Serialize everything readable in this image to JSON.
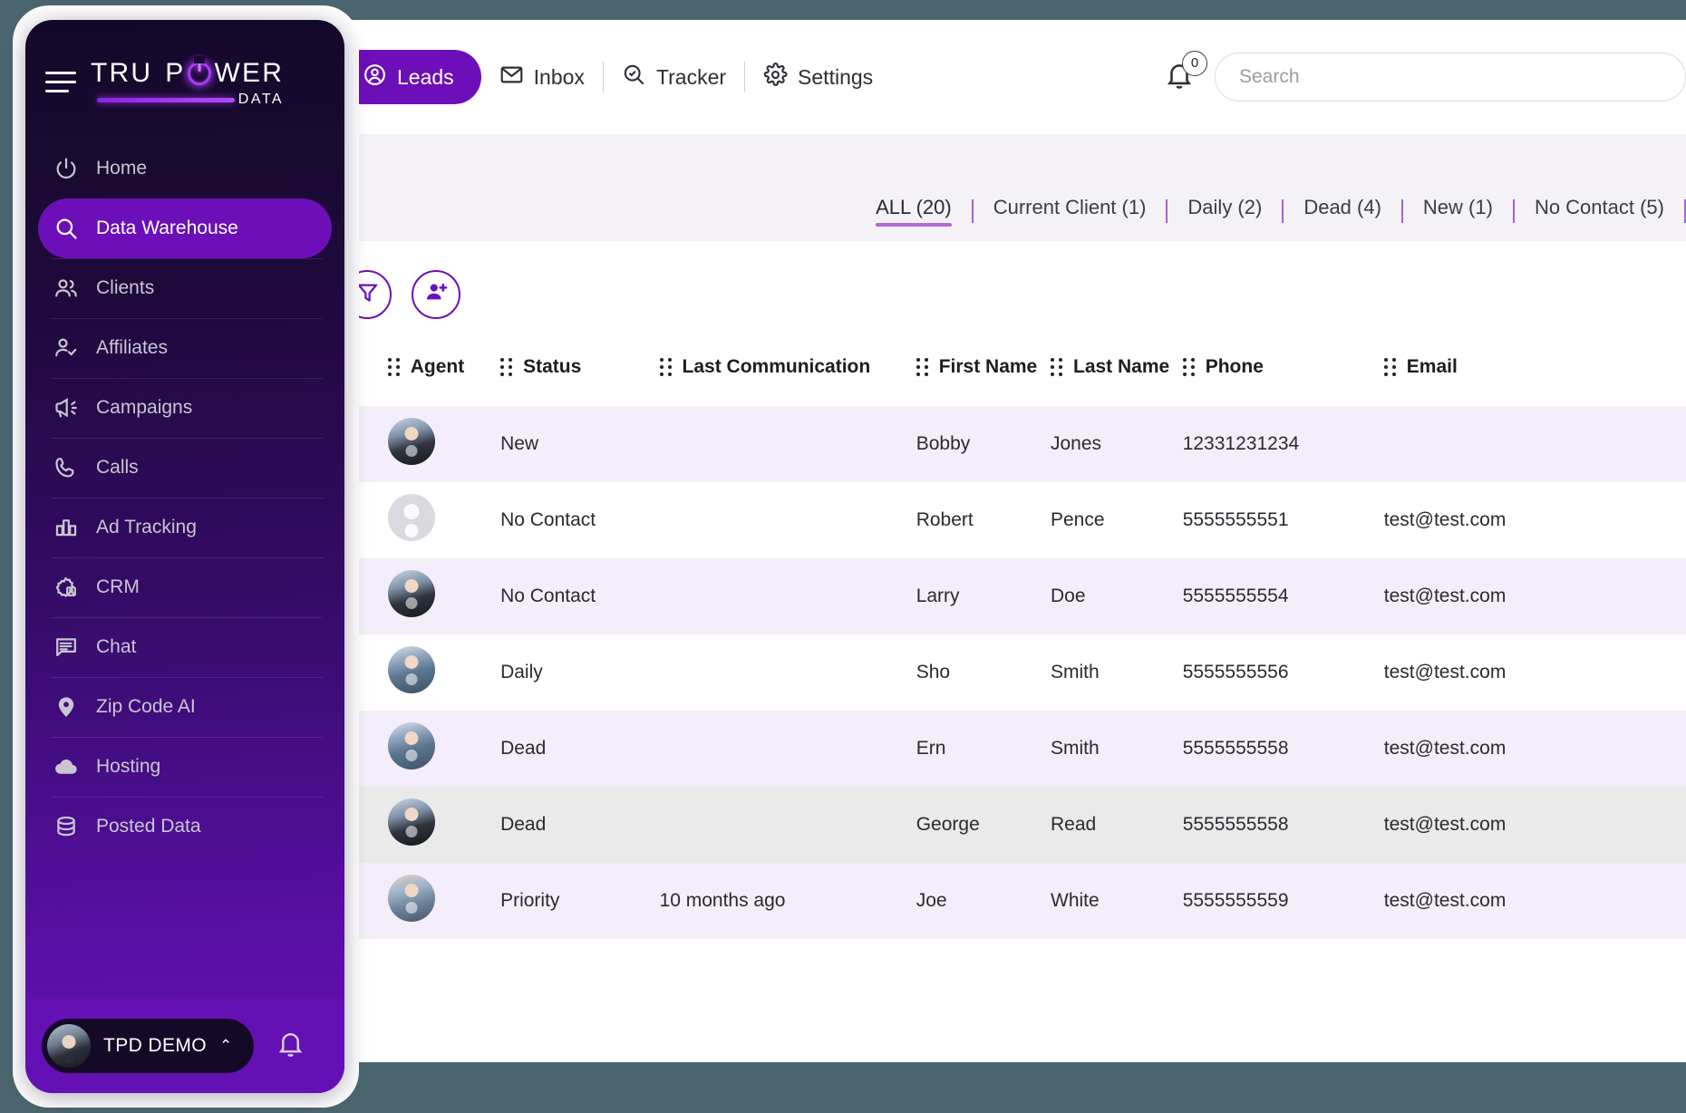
{
  "brand": {
    "line1_a": "TRU",
    "line1_b": "P",
    "line1_c": "WER",
    "line2": "DATA"
  },
  "sidebar": {
    "items": [
      {
        "label": "Home",
        "icon": "power-icon",
        "active": false
      },
      {
        "label": "Data Warehouse",
        "icon": "search-icon",
        "active": true
      },
      {
        "label": "Clients",
        "icon": "users-icon",
        "active": false
      },
      {
        "label": "Affiliates",
        "icon": "user-check-icon",
        "active": false
      },
      {
        "label": "Campaigns",
        "icon": "megaphone-icon",
        "active": false
      },
      {
        "label": "Calls",
        "icon": "phone-icon",
        "active": false
      },
      {
        "label": "Ad Tracking",
        "icon": "bar-chart-icon",
        "active": false
      },
      {
        "label": "CRM",
        "icon": "gear-contact-icon",
        "active": false
      },
      {
        "label": "Chat",
        "icon": "chat-icon",
        "active": false
      },
      {
        "label": "Zip Code AI",
        "icon": "map-pin-icon",
        "active": false
      },
      {
        "label": "Hosting",
        "icon": "cloud-icon",
        "active": false
      },
      {
        "label": "Posted Data",
        "icon": "database-icon",
        "active": false
      }
    ],
    "footer": {
      "user_name": "TPD DEMO",
      "chevron": "⌃",
      "bell_icon": "bell-icon",
      "avatar_icon": "avatar"
    }
  },
  "topnav": {
    "tabs": [
      {
        "label": "Leads",
        "icon": "user-circle-icon",
        "active": true
      },
      {
        "label": "Inbox",
        "icon": "envelope-icon",
        "active": false
      },
      {
        "label": "Tracker",
        "icon": "search-check-icon",
        "active": false
      },
      {
        "label": "Settings",
        "icon": "gear-icon",
        "active": false
      }
    ],
    "notifications": {
      "icon": "bell-icon",
      "count": "0"
    },
    "search": {
      "placeholder": "Search",
      "value": ""
    }
  },
  "filters": {
    "tabs": [
      {
        "label": "ALL (20)",
        "active": true
      },
      {
        "label": "Current Client (1)",
        "active": false
      },
      {
        "label": "Daily (2)",
        "active": false
      },
      {
        "label": "Dead (4)",
        "active": false
      },
      {
        "label": "New (1)",
        "active": false
      },
      {
        "label": "No Contact (5)",
        "active": false
      }
    ]
  },
  "actions": {
    "filter_button": "filter-icon",
    "add_lead_button": "add-user-icon"
  },
  "table": {
    "columns": [
      "Agent",
      "Status",
      "Last Communication",
      "First Name",
      "Last Name",
      "Phone",
      "Email"
    ],
    "rows": [
      {
        "avatar": "av-a",
        "status": "New",
        "last_communication": "",
        "first_name": "Bobby",
        "last_name": "Jones",
        "phone": "12331231234",
        "email": ""
      },
      {
        "avatar": "av-b",
        "status": "No Contact",
        "last_communication": "",
        "first_name": "Robert",
        "last_name": "Pence",
        "phone": "5555555551",
        "email": "test@test.com"
      },
      {
        "avatar": "av-a",
        "status": "No Contact",
        "last_communication": "",
        "first_name": "Larry",
        "last_name": "Doe",
        "phone": "5555555554",
        "email": "test@test.com"
      },
      {
        "avatar": "av-c",
        "status": "Daily",
        "last_communication": "",
        "first_name": "Sho",
        "last_name": "Smith",
        "phone": "5555555556",
        "email": "test@test.com"
      },
      {
        "avatar": "av-c",
        "status": "Dead",
        "last_communication": "",
        "first_name": "Ern",
        "last_name": "Smith",
        "phone": "5555555558",
        "email": "test@test.com"
      },
      {
        "avatar": "av-a",
        "status": "Dead",
        "last_communication": "",
        "first_name": "George",
        "last_name": "Read",
        "phone": "5555555558",
        "email": "test@test.com"
      },
      {
        "avatar": "av-d",
        "status": "Priority",
        "last_communication": "10 months ago",
        "first_name": "Joe",
        "last_name": "White",
        "phone": "5555555559",
        "email": "test@test.com"
      }
    ]
  },
  "colors": {
    "page_background": "#4c6670",
    "brand_purple": "#6c0fb8",
    "accent_violet": "#a93cf5",
    "row_band": "#f4eefa",
    "row_hover": "#eaeaea",
    "strip_background": "#f4f2f7"
  }
}
